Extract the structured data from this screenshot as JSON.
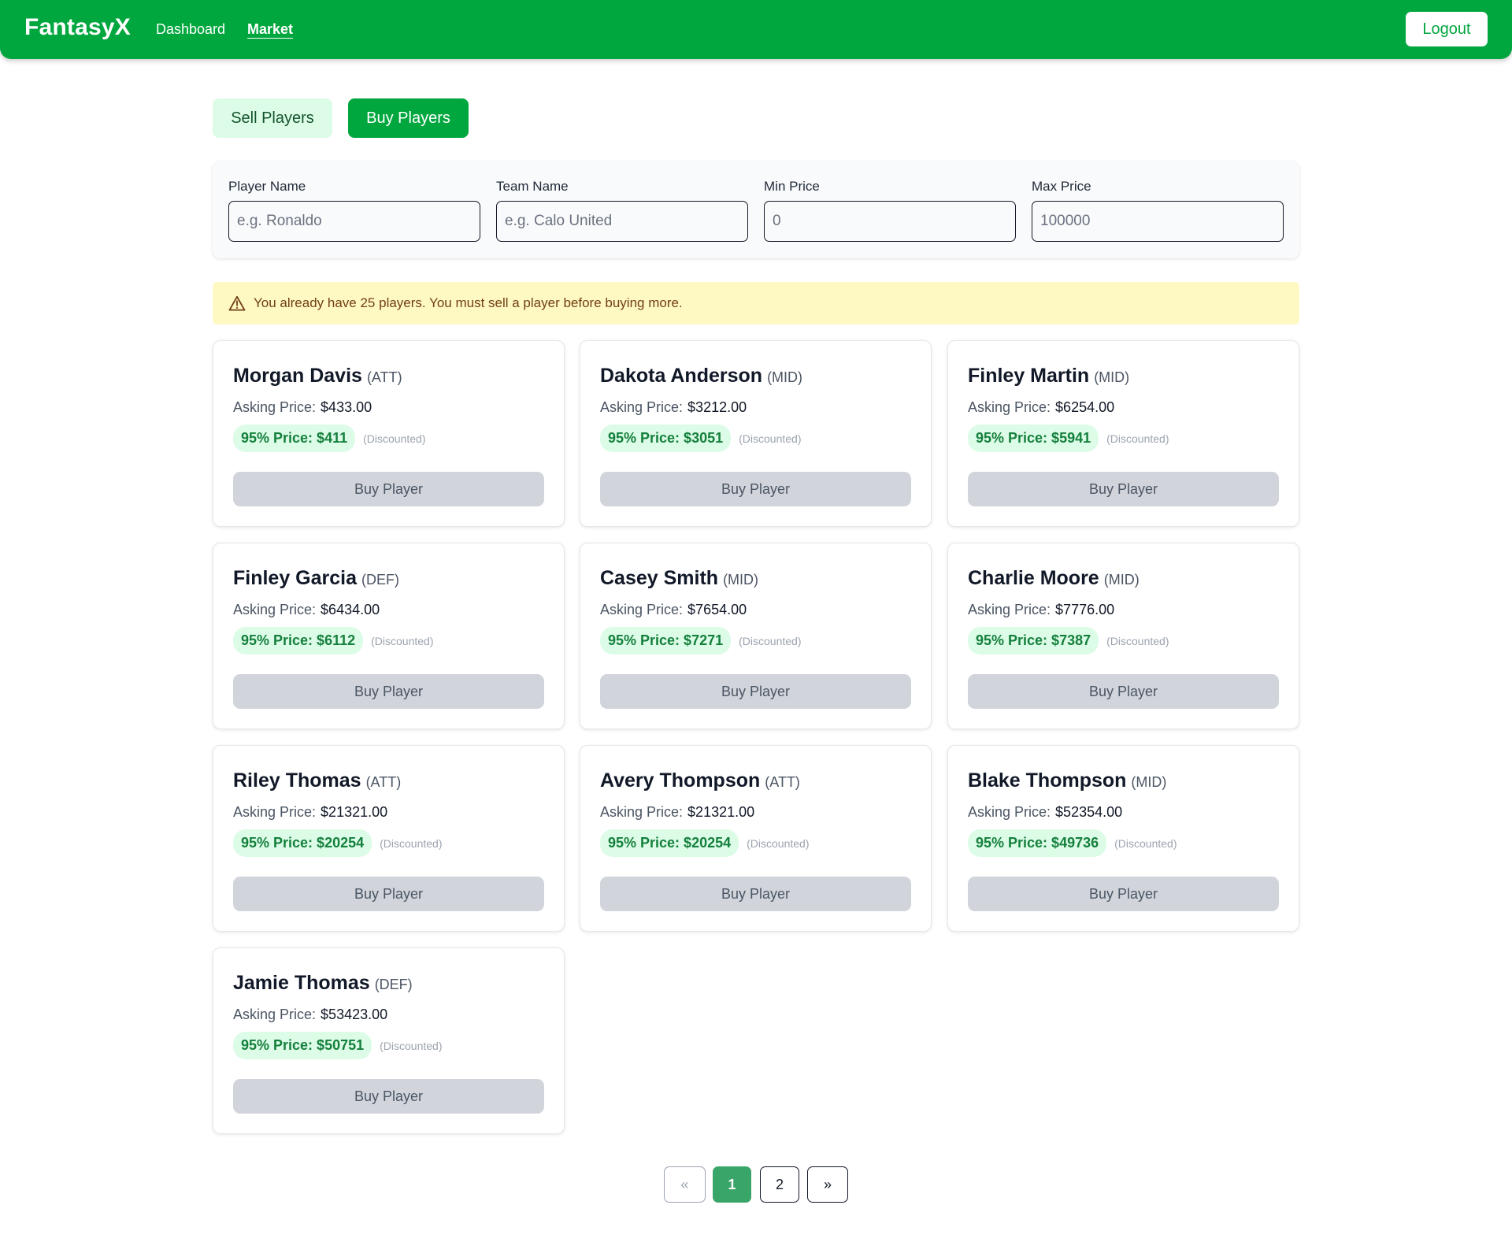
{
  "navbar": {
    "brand": "FantasyX",
    "links": [
      "Dashboard",
      "Market"
    ],
    "active_link": "Market",
    "logout_label": "Logout"
  },
  "tabs": {
    "sell_label": "Sell Players",
    "buy_label": "Buy Players",
    "active": "Buy Players"
  },
  "filters": {
    "player_name": {
      "label": "Player Name",
      "placeholder": "e.g. Ronaldo",
      "value": ""
    },
    "team_name": {
      "label": "Team Name",
      "placeholder": "e.g. Calo United",
      "value": ""
    },
    "min_price": {
      "label": "Min Price",
      "placeholder": "",
      "value": "0"
    },
    "max_price": {
      "label": "Max Price",
      "placeholder": "",
      "value": "100000"
    }
  },
  "warning": {
    "icon": "warning-triangle-icon",
    "text": "You already have 25 players. You must sell a player before buying more."
  },
  "card_labels": {
    "asking_label": "Asking Price:",
    "discount_note": "(Discounted)",
    "buy_label": "Buy Player"
  },
  "players": [
    {
      "name": "Morgan Davis",
      "position": "(ATT)",
      "asking": "$433.00",
      "discount": "95% Price: $411"
    },
    {
      "name": "Dakota Anderson",
      "position": "(MID)",
      "asking": "$3212.00",
      "discount": "95% Price: $3051"
    },
    {
      "name": "Finley Martin",
      "position": "(MID)",
      "asking": "$6254.00",
      "discount": "95% Price: $5941"
    },
    {
      "name": "Finley Garcia",
      "position": "(DEF)",
      "asking": "$6434.00",
      "discount": "95% Price: $6112"
    },
    {
      "name": "Casey Smith",
      "position": "(MID)",
      "asking": "$7654.00",
      "discount": "95% Price: $7271"
    },
    {
      "name": "Charlie Moore",
      "position": "(MID)",
      "asking": "$7776.00",
      "discount": "95% Price: $7387"
    },
    {
      "name": "Riley Thomas",
      "position": "(ATT)",
      "asking": "$21321.00",
      "discount": "95% Price: $20254"
    },
    {
      "name": "Avery Thompson",
      "position": "(ATT)",
      "asking": "$21321.00",
      "discount": "95% Price: $20254"
    },
    {
      "name": "Blake Thompson",
      "position": "(MID)",
      "asking": "$52354.00",
      "discount": "95% Price: $49736"
    },
    {
      "name": "Jamie Thomas",
      "position": "(DEF)",
      "asking": "$53423.00",
      "discount": "95% Price: $50751"
    }
  ],
  "pagination": {
    "prev": "«",
    "pages": [
      "1",
      "2"
    ],
    "current": "1",
    "next": "»"
  },
  "colors": {
    "brand_green": "#00a63e",
    "badge_green_bg": "#dcfce7",
    "badge_green_text": "#15803d",
    "warning_bg": "#fef9c3",
    "disabled_button": "#d1d5db",
    "pager_current": "#3aa569"
  }
}
